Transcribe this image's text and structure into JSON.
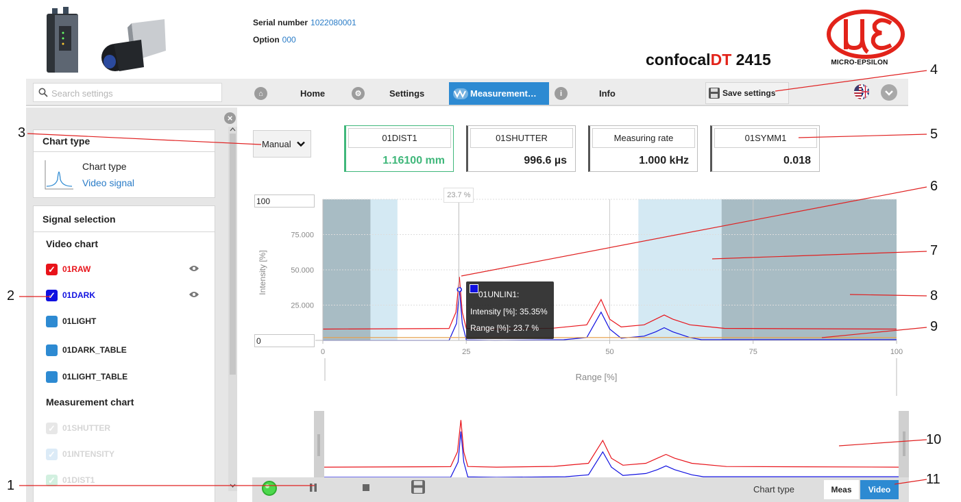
{
  "header": {
    "serial_label": "Serial number",
    "serial_value": "1022080001",
    "option_label": "Option",
    "option_value": "000",
    "product_prefix": "confocal",
    "product_dt": "DT",
    "product_model": "2415",
    "brand": "MICRO-EPSILON"
  },
  "nav": {
    "search_placeholder": "Search settings",
    "home": "Home",
    "settings": "Settings",
    "measurement": "Measurement…",
    "info": "Info",
    "save": "Save settings"
  },
  "sidebar": {
    "chart_type_title": "Chart type",
    "chart_type_label": "Chart type",
    "chart_type_value": "Video signal",
    "signal_title": "Signal selection",
    "video_chart_title": "Video chart",
    "measurement_chart_title": "Measurement chart",
    "video_signals": [
      {
        "name": "01RAW",
        "checked": true,
        "color": "#e8131a"
      },
      {
        "name": "01DARK",
        "checked": true,
        "color": "#1010e0"
      },
      {
        "name": "01LIGHT",
        "checked": false,
        "color": "#2d8ad2"
      },
      {
        "name": "01DARK_TABLE",
        "checked": false,
        "color": "#2d8ad2"
      },
      {
        "name": "01LIGHT_TABLE",
        "checked": false,
        "color": "#2d8ad2"
      }
    ],
    "measurement_signals": [
      {
        "name": "01SHUTTER"
      },
      {
        "name": "01INTENSITY"
      },
      {
        "name": "01DIST1"
      }
    ]
  },
  "controls": {
    "mode": "Manual"
  },
  "cards": [
    {
      "label": "01DIST1",
      "value": "1.16100  mm",
      "color": "#3fb77a"
    },
    {
      "label": "01SHUTTER",
      "value": "996.6  µs",
      "color": "#222222"
    },
    {
      "label": "Measuring rate",
      "value": "1.000  kHz",
      "color": "#222222"
    },
    {
      "label": "01SYMM1",
      "value": "0.018",
      "color": "#222222"
    }
  ],
  "chart_data": {
    "type": "line",
    "xlabel": "Range [%]",
    "ylabel": "Intensity [%]",
    "xlim": [
      0,
      100
    ],
    "ylim": [
      0,
      100
    ],
    "x_ticks": [
      "0",
      "25",
      "50",
      "75",
      "100"
    ],
    "y_ticks": [
      "75.000",
      "50.000",
      "25.000"
    ],
    "y_max_input": "100",
    "y_min_input": "0",
    "cursor_label": "23.7 %",
    "tooltip": {
      "series": "01UNLIN1:",
      "intensity": "Intensity [%]: 35.35%",
      "range": "Range [%]: 23.7 %"
    },
    "series": [
      {
        "name": "01RAW",
        "color": "#e8131a",
        "x": [
          0,
          22,
          23.2,
          23.8,
          24.3,
          25,
          30,
          40,
          46,
          48.5,
          50,
          52,
          56,
          58,
          59.5,
          61,
          64,
          70,
          100
        ],
        "y": [
          8,
          8.4,
          20,
          45,
          20,
          8.5,
          8,
          8.6,
          11,
          29,
          15,
          9.5,
          11,
          15,
          18,
          15,
          11,
          8.5,
          8
        ]
      },
      {
        "name": "01DARK",
        "color": "#1010e0",
        "x": [
          0,
          22,
          23.3,
          23.8,
          24.3,
          25,
          30,
          42,
          46,
          48.5,
          50,
          52,
          56,
          58,
          59.5,
          61,
          64,
          66,
          100
        ],
        "y": [
          0,
          0,
          12,
          36,
          12,
          0.3,
          0,
          0.5,
          2,
          20,
          8,
          1.5,
          3,
          6,
          9,
          6,
          2,
          0.5,
          0.5
        ]
      },
      {
        "name": "threshold",
        "color": "#e6a04e",
        "x": [
          0,
          100
        ],
        "y": [
          2,
          2
        ]
      }
    ]
  },
  "bottom": {
    "chart_type_label": "Chart type",
    "meas": "Meas",
    "video": "Video"
  },
  "annotations": [
    "1",
    "2",
    "3",
    "4",
    "5",
    "6",
    "7",
    "8",
    "9",
    "10",
    "11"
  ]
}
